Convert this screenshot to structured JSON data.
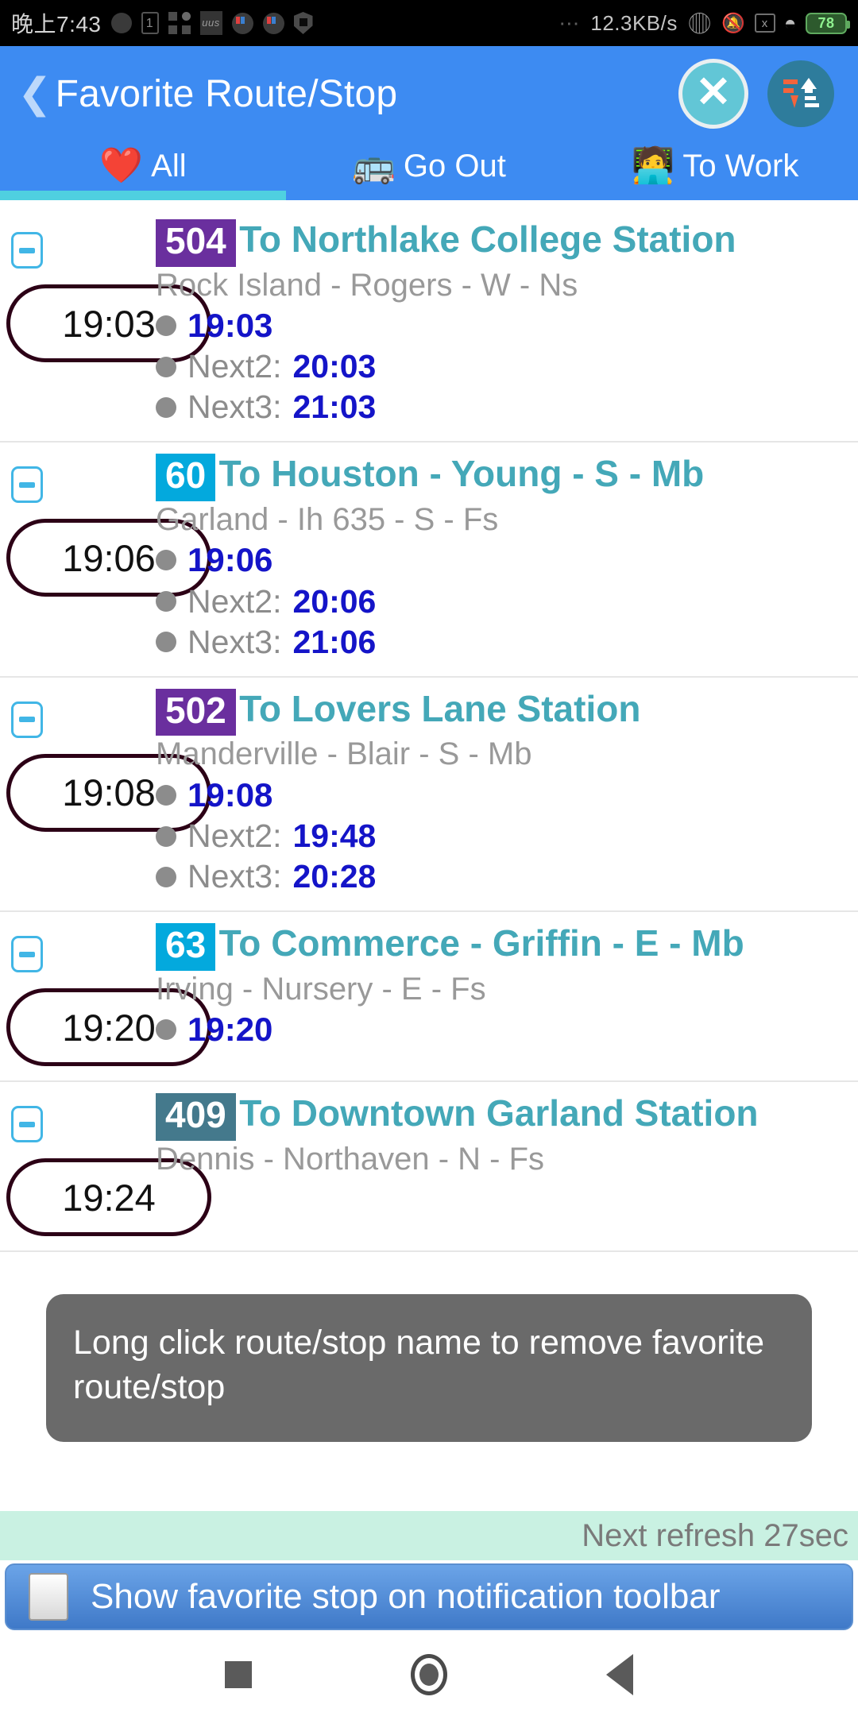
{
  "status_bar": {
    "clock": "晚上7:43",
    "network_speed": "12.3KB/s",
    "battery": "78",
    "icons": [
      "sun-icon",
      "sim-card-icon",
      "apps-grid-icon",
      "note-icon",
      "color-app-icon",
      "color-app-icon-2",
      "shield-icon",
      "more-dots-icon",
      "bluetooth-icon",
      "bell-muted-icon",
      "xbox-icon",
      "wifi-icon",
      "battery-icon"
    ]
  },
  "appbar": {
    "back_label": "❮",
    "title": "Favorite Route/Stop",
    "close_label": "✕",
    "close_icon": "close-circle-icon",
    "sort_icon": "sort-updown-icon"
  },
  "tabs": [
    {
      "emoji": "❤️",
      "label": "All",
      "icon": "heart-icon",
      "active": true
    },
    {
      "emoji": "🚌",
      "label": "Go Out",
      "icon": "bus-icon",
      "active": false
    },
    {
      "emoji": "🧑‍💻",
      "label": "To Work",
      "icon": "desk-worker-icon",
      "active": false
    }
  ],
  "list": [
    {
      "collapse_icon": "minus-box-icon",
      "badge": "504",
      "badge_color": "#6a2f9e",
      "route_name": "To Northlake College Station",
      "stop_name": "Rock Island - Rogers - W - Ns",
      "pill_time": "19:03",
      "arrivals": [
        {
          "label": "",
          "time": "19:03"
        },
        {
          "label": "Next2:",
          "time": "20:03"
        },
        {
          "label": "Next3:",
          "time": "21:03"
        }
      ]
    },
    {
      "collapse_icon": "minus-box-icon",
      "badge": "60",
      "badge_color": "#03a9dd",
      "route_name": "To Houston - Young - S - Mb",
      "stop_name": "Garland - Ih 635 - S - Fs",
      "pill_time": "19:06",
      "arrivals": [
        {
          "label": "",
          "time": "19:06"
        },
        {
          "label": "Next2:",
          "time": "20:06"
        },
        {
          "label": "Next3:",
          "time": "21:06"
        }
      ]
    },
    {
      "collapse_icon": "minus-box-icon",
      "badge": "502",
      "badge_color": "#6a2f9e",
      "route_name": "To Lovers Lane Station",
      "stop_name": "Manderville - Blair - S - Mb",
      "pill_time": "19:08",
      "arrivals": [
        {
          "label": "",
          "time": "19:08"
        },
        {
          "label": "Next2:",
          "time": "19:48"
        },
        {
          "label": "Next3:",
          "time": "20:28"
        }
      ]
    },
    {
      "collapse_icon": "minus-box-icon",
      "badge": "63",
      "badge_color": "#03a9dd",
      "route_name": "To Commerce - Griffin - E - Mb",
      "stop_name": "Irving - Nursery - E - Fs",
      "pill_time": "19:20",
      "arrivals": [
        {
          "label": "",
          "time": "19:20"
        }
      ]
    },
    {
      "collapse_icon": "minus-box-icon",
      "badge": "409",
      "badge_color": "#44798c",
      "route_name": "To Downtown Garland Station",
      "stop_name": "Dennis - Northaven - N - Fs",
      "pill_time": "19:24",
      "arrivals": []
    }
  ],
  "toast": {
    "message": "Long click route/stop name to remove favorite route/stop"
  },
  "refresh_bar": {
    "text": "Next refresh 27sec"
  },
  "notification_toggle": {
    "label": "Show favorite stop on notification toolbar",
    "checked": false
  },
  "navbar": {
    "recent_icon": "square-icon",
    "home_icon": "circle-icon",
    "back_icon": "triangle-back-icon"
  }
}
